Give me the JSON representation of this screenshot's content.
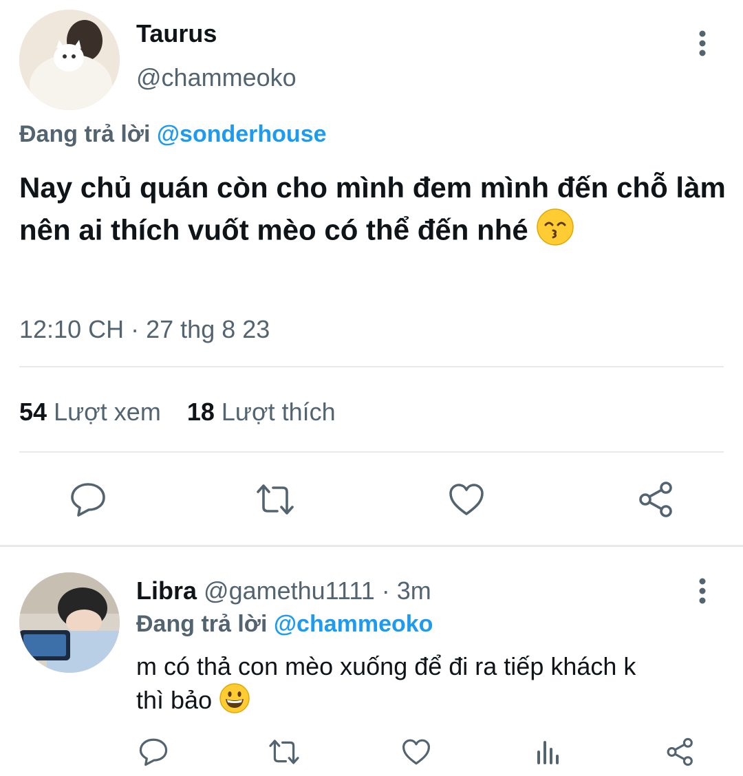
{
  "tweet": {
    "author_name": "Taurus",
    "author_handle": "@chammeoko",
    "reply_prefix": "Đang trả lời",
    "reply_to": "@sonderhouse",
    "text": "Nay chủ quán còn cho mình đem mình đến chỗ làm nên ai thích vuốt mèo có thể đến nhé",
    "emoji": "kissing-smiling-eyes",
    "time": "12:10 CH",
    "date": "27 thg 8 23",
    "views_count": "54",
    "views_label": "Lượt xem",
    "likes_count": "18",
    "likes_label": "Lượt thích"
  },
  "reply": {
    "author_name": "Libra",
    "author_handle": "@gamethu1111",
    "time_ago": "· 3m",
    "reply_prefix": "Đang trả lời",
    "reply_to": "@chammeoko",
    "text_line1": "m có thả con mèo xuống để đi ra tiếp khách k",
    "text_line2": "thì bảo",
    "emoji": "grinning-face"
  },
  "icons": {
    "more": "more-vertical-icon",
    "reply": "comment-icon",
    "retweet": "retweet-icon",
    "like": "heart-icon",
    "share": "share-icon",
    "views": "analytics-icon"
  },
  "colors": {
    "accent": "#1d9bf0",
    "secondary_text": "#536471",
    "divider": "#e7e9ea"
  }
}
